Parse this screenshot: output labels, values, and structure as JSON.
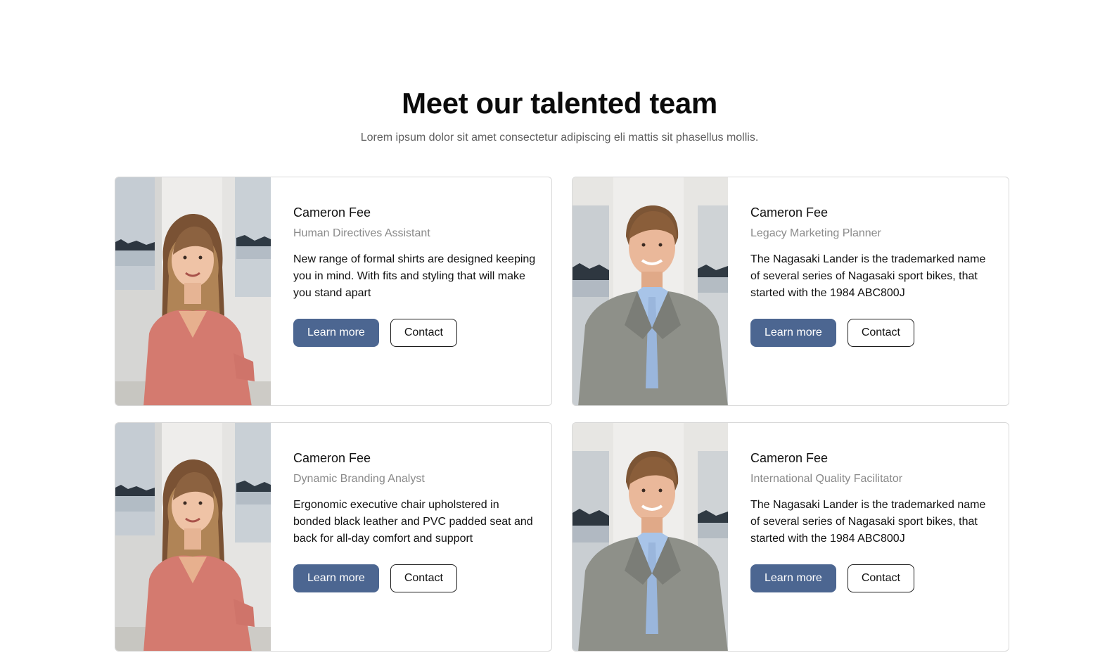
{
  "section": {
    "title": "Meet our talented team",
    "subtitle": "Lorem ipsum dolor sit amet consectetur adipiscing eli mattis sit phasellus mollis."
  },
  "colors": {
    "primary_button": "#4c6691",
    "role_text": "#8a8a8a"
  },
  "members": [
    {
      "name": "Cameron Fee",
      "role": "Human Directives Assistant",
      "description": "New range of formal shirts are designed keeping you in mind. With fits and styling that will make you stand apart",
      "photo": "woman-portrait",
      "primary_label": "Learn more",
      "secondary_label": "Contact"
    },
    {
      "name": "Cameron Fee",
      "role": "Legacy Marketing Planner",
      "description": "The Nagasaki Lander is the trademarked name of several series of Nagasaki sport bikes, that started with the 1984 ABC800J",
      "photo": "man-portrait",
      "primary_label": "Learn more",
      "secondary_label": "Contact"
    },
    {
      "name": "Cameron Fee",
      "role": "Dynamic Branding Analyst",
      "description": "Ergonomic executive chair upholstered in bonded black leather and PVC padded seat and back for all-day comfort and support",
      "photo": "woman-portrait",
      "primary_label": "Learn more",
      "secondary_label": "Contact"
    },
    {
      "name": "Cameron Fee",
      "role": "International Quality Facilitator",
      "description": "The Nagasaki Lander is the trademarked name of several series of Nagasaki sport bikes, that started with the 1984 ABC800J",
      "photo": "man-portrait",
      "primary_label": "Learn more",
      "secondary_label": "Contact"
    }
  ]
}
